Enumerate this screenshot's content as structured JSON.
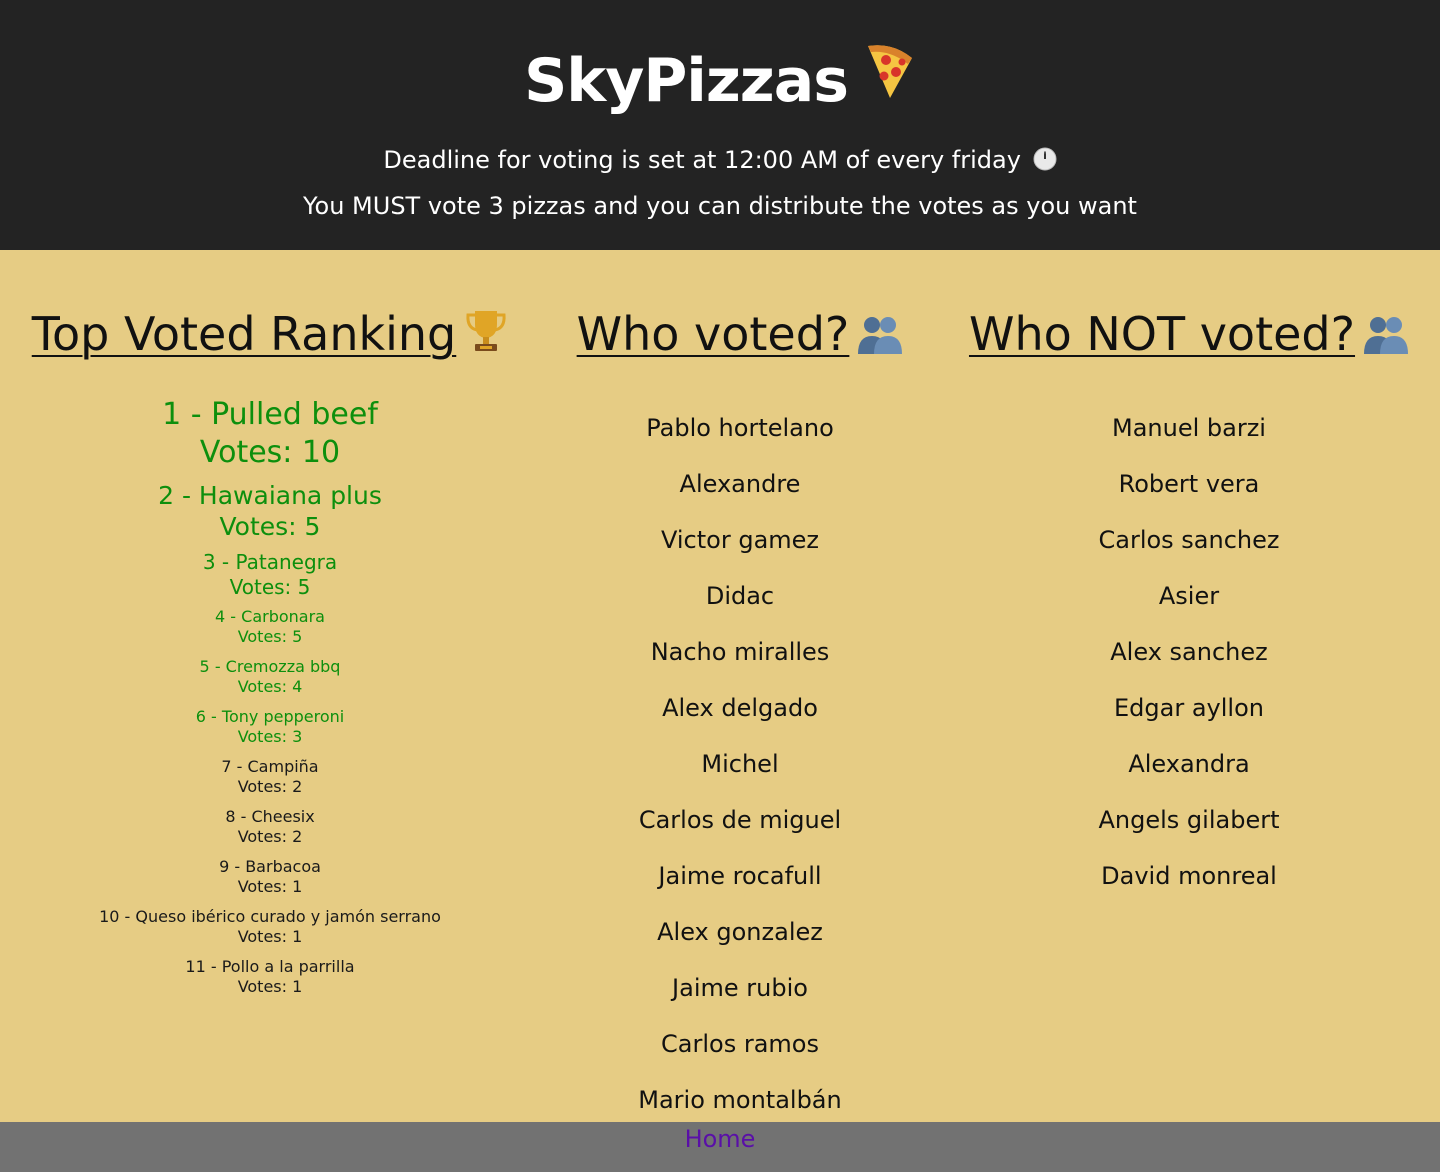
{
  "header": {
    "title": "SkyPizzas",
    "title_icon": "pizza-slice",
    "deadline_text": "Deadline for voting is set at 12:00 AM of every friday",
    "deadline_icon": "clock",
    "rule_text": "You MUST vote 3 pizzas and you can distribute the votes as you want"
  },
  "ranking": {
    "heading": "Top Voted Ranking",
    "heading_icon": "trophy",
    "highlight_color": "#0d8f0d",
    "items": [
      {
        "label": "1 - Pulled beef",
        "votes": "Votes: 10"
      },
      {
        "label": "2 - Hawaiana plus",
        "votes": "Votes: 5"
      },
      {
        "label": "3 - Patanegra",
        "votes": "Votes: 5"
      },
      {
        "label": "4 - Carbonara",
        "votes": "Votes: 5"
      },
      {
        "label": "5 - Cremozza bbq",
        "votes": "Votes: 4"
      },
      {
        "label": "6 - Tony pepperoni",
        "votes": "Votes: 3"
      },
      {
        "label": "7 - Campiña",
        "votes": "Votes: 2"
      },
      {
        "label": "8 - Cheesix",
        "votes": "Votes: 2"
      },
      {
        "label": "9 - Barbacoa",
        "votes": "Votes: 1"
      },
      {
        "label": "10 - Queso ibérico curado y jamón serrano",
        "votes": "Votes: 1"
      },
      {
        "label": "11 - Pollo a la parrilla",
        "votes": "Votes: 1"
      }
    ]
  },
  "voted": {
    "heading": "Who voted?",
    "heading_icon": "users",
    "names": [
      "Pablo hortelano",
      "Alexandre",
      "Victor gamez",
      "Didac",
      "Nacho miralles",
      "Alex delgado",
      "Michel",
      "Carlos de miguel",
      "Jaime rocafull",
      "Alex gonzalez",
      "Jaime rubio",
      "Carlos ramos",
      "Mario montalbán"
    ]
  },
  "not_voted": {
    "heading": "Who NOT voted?",
    "heading_icon": "users",
    "names": [
      "Manuel barzi",
      "Robert vera",
      "Carlos sanchez",
      "Asier",
      "Alex sanchez",
      "Edgar ayllon",
      "Alexandra",
      "Angels gilabert",
      "David monreal"
    ]
  },
  "footer": {
    "home_label": "Home",
    "link_color": "#5a0fa8"
  },
  "colors": {
    "header_bg": "#232323",
    "page_bg": "#e6cc84",
    "footer_bg": "#727272"
  }
}
